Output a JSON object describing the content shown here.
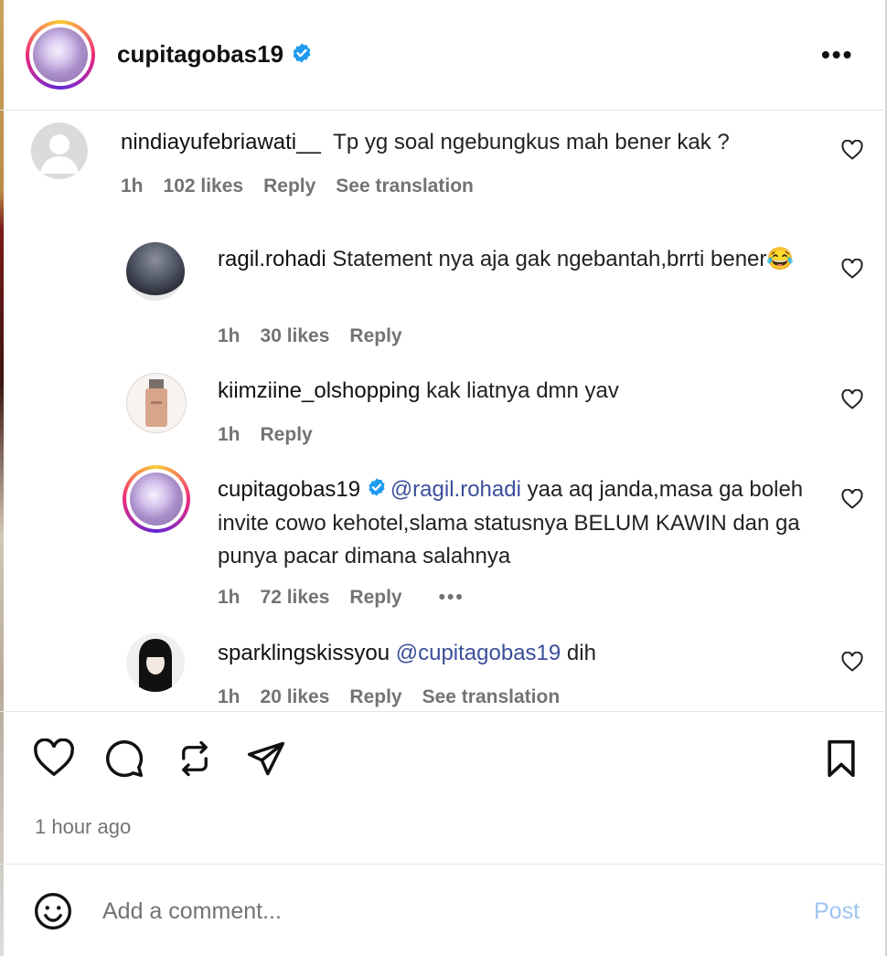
{
  "post": {
    "author": "cupitagobas19",
    "timestamp": "1 hour ago"
  },
  "comments": [
    {
      "user": "nindiayufebriawati__",
      "text": "Tp yg soal ngebungkus mah bener kak ?",
      "time": "1h",
      "likes": "102 likes",
      "reply": "Reply",
      "translate": "See translation"
    },
    {
      "user": "ragil.rohadi",
      "text": "Statement nya aja gak ngebantah,brrti bener",
      "emoji": "😂",
      "time": "1h",
      "likes": "30 likes",
      "reply": "Reply"
    },
    {
      "user": "kiimziine_olshopping",
      "text": "kak liatnya dmn yav",
      "time": "1h",
      "reply": "Reply"
    },
    {
      "user": "cupitagobas19",
      "mention": "@ragil.rohadi",
      "text": "yaa aq janda,masa ga boleh invite cowo kehotel,slama statusnya BELUM KAWIN dan ga punya pacar dimana salahnya",
      "time": "1h",
      "likes": "72 likes",
      "reply": "Reply",
      "more": "•••"
    },
    {
      "user": "sparklingskissyou",
      "mention": "@cupitagobas19",
      "text": "dih",
      "time": "1h",
      "likes": "20 likes",
      "reply": "Reply",
      "translate": "See translation"
    }
  ],
  "composer": {
    "placeholder": "Add a comment...",
    "post_label": "Post"
  },
  "header": {
    "more_label": "•••"
  },
  "icons": {
    "verified": "verified-badge-icon",
    "like": "heart-icon",
    "comment": "comment-bubble-icon",
    "repost": "repost-icon",
    "share": "paper-plane-icon",
    "save": "bookmark-icon",
    "emoji": "smiley-icon"
  },
  "colors": {
    "verified": "#1d9bf0",
    "mention": "#3b4f9a",
    "post_button": "#9fc4f0",
    "muted_text": "#737373"
  }
}
